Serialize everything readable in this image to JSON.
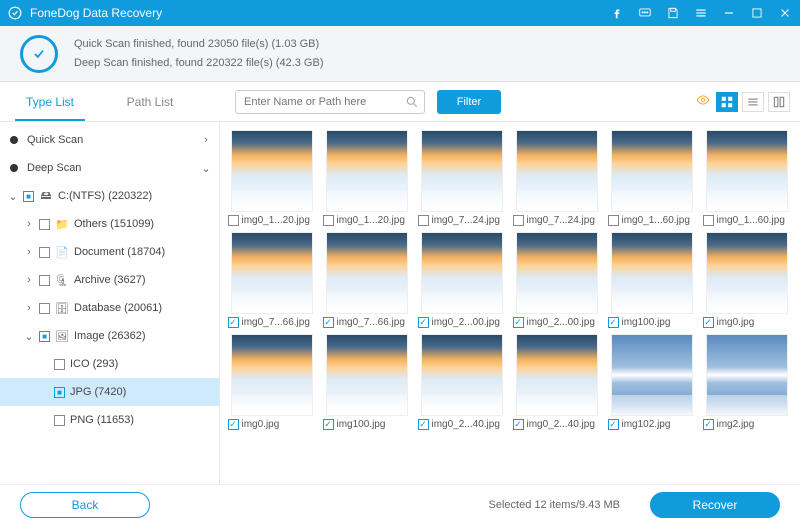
{
  "app": {
    "title": "FoneDog Data Recovery"
  },
  "status": {
    "line1": "Quick Scan finished, found 23050 file(s) (1.03 GB)",
    "line2": "Deep Scan finished, found 220322 file(s) (42.3 GB)"
  },
  "tabs": {
    "typeList": "Type List",
    "pathList": "Path List"
  },
  "search": {
    "placeholder": "Enter Name or Path here"
  },
  "filter": {
    "label": "Filter"
  },
  "tree": {
    "quickScan": "Quick Scan",
    "deepScan": "Deep Scan",
    "drive": "C:(NTFS) (220322)",
    "others": "Others (151099)",
    "document": "Document (18704)",
    "archive": "Archive (3627)",
    "database": "Database (20061)",
    "image": "Image (26362)",
    "ico": "ICO (293)",
    "jpg": "JPG (7420)",
    "png": "PNG (11653)"
  },
  "thumbs": [
    {
      "name": "img0_1...20.jpg",
      "checked": false,
      "style": "sky"
    },
    {
      "name": "img0_1...20.jpg",
      "checked": false,
      "style": "sky"
    },
    {
      "name": "img0_7...24.jpg",
      "checked": false,
      "style": "sky"
    },
    {
      "name": "img0_7...24.jpg",
      "checked": false,
      "style": "sky"
    },
    {
      "name": "img0_1...60.jpg",
      "checked": false,
      "style": "sky"
    },
    {
      "name": "img0_1...60.jpg",
      "checked": false,
      "style": "sky"
    },
    {
      "name": "img0_7...66.jpg",
      "checked": true,
      "style": "sky"
    },
    {
      "name": "img0_7...66.jpg",
      "checked": true,
      "style": "sky"
    },
    {
      "name": "img0_2...00.jpg",
      "checked": true,
      "style": "sky"
    },
    {
      "name": "img0_2...00.jpg",
      "checked": true,
      "style": "sky"
    },
    {
      "name": "img100.jpg",
      "checked": true,
      "style": "sky"
    },
    {
      "name": "img0.jpg",
      "checked": true,
      "style": "sky"
    },
    {
      "name": "img0.jpg",
      "checked": true,
      "style": "sky"
    },
    {
      "name": "img100.jpg",
      "checked": true,
      "style": "sky"
    },
    {
      "name": "img0_2...40.jpg",
      "checked": true,
      "style": "sky"
    },
    {
      "name": "img0_2...40.jpg",
      "checked": true,
      "style": "sky"
    },
    {
      "name": "img102.jpg",
      "checked": true,
      "style": "reflect"
    },
    {
      "name": "img2.jpg",
      "checked": true,
      "style": "reflect"
    }
  ],
  "footer": {
    "back": "Back",
    "selected": "Selected 12 items/9.43 MB",
    "recover": "Recover"
  }
}
